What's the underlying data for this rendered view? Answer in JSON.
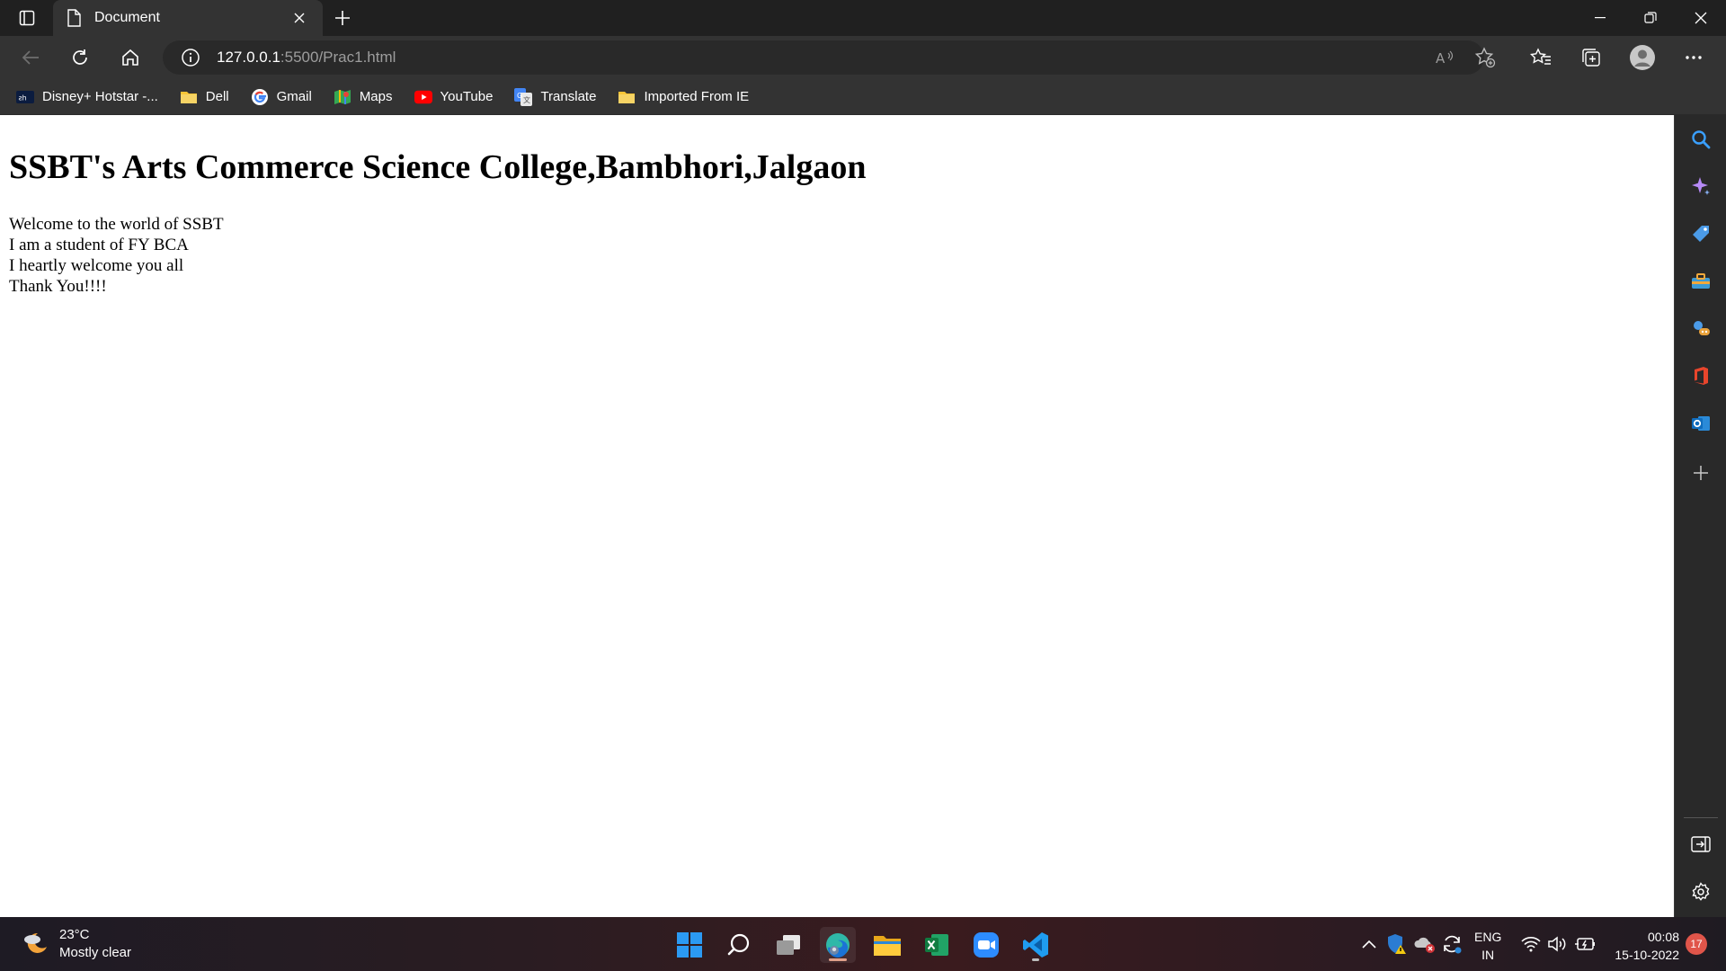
{
  "browser": {
    "tab": {
      "title": "Document"
    },
    "address": {
      "host": "127.0.0.1",
      "path": ":5500/Prac1.html"
    },
    "favorites": [
      {
        "label": "Disney+ Hotstar -...",
        "icon": "hotstar-icon"
      },
      {
        "label": "Dell",
        "icon": "folder-icon"
      },
      {
        "label": "Gmail",
        "icon": "google-icon"
      },
      {
        "label": "Maps",
        "icon": "maps-icon"
      },
      {
        "label": "YouTube",
        "icon": "youtube-icon"
      },
      {
        "label": "Translate",
        "icon": "translate-icon"
      },
      {
        "label": "Imported From IE",
        "icon": "folder-icon"
      }
    ]
  },
  "page": {
    "heading": "SSBT's Arts Commerce Science College,Bambhori,Jalgaon",
    "lines": [
      "Welcome to the world of SSBT",
      "I am a student of FY BCA",
      "I heartly welcome you all",
      "Thank You!!!!"
    ]
  },
  "taskbar": {
    "weather": {
      "temp": "23°C",
      "condition": "Mostly clear"
    },
    "language": {
      "lang": "ENG",
      "region": "IN"
    },
    "clock": {
      "time": "00:08",
      "date": "15-10-2022"
    },
    "notifications": "17"
  },
  "colors": {
    "accent": "#0078d4",
    "page_bg": "#ffffff",
    "chrome_bg": "#333333"
  }
}
